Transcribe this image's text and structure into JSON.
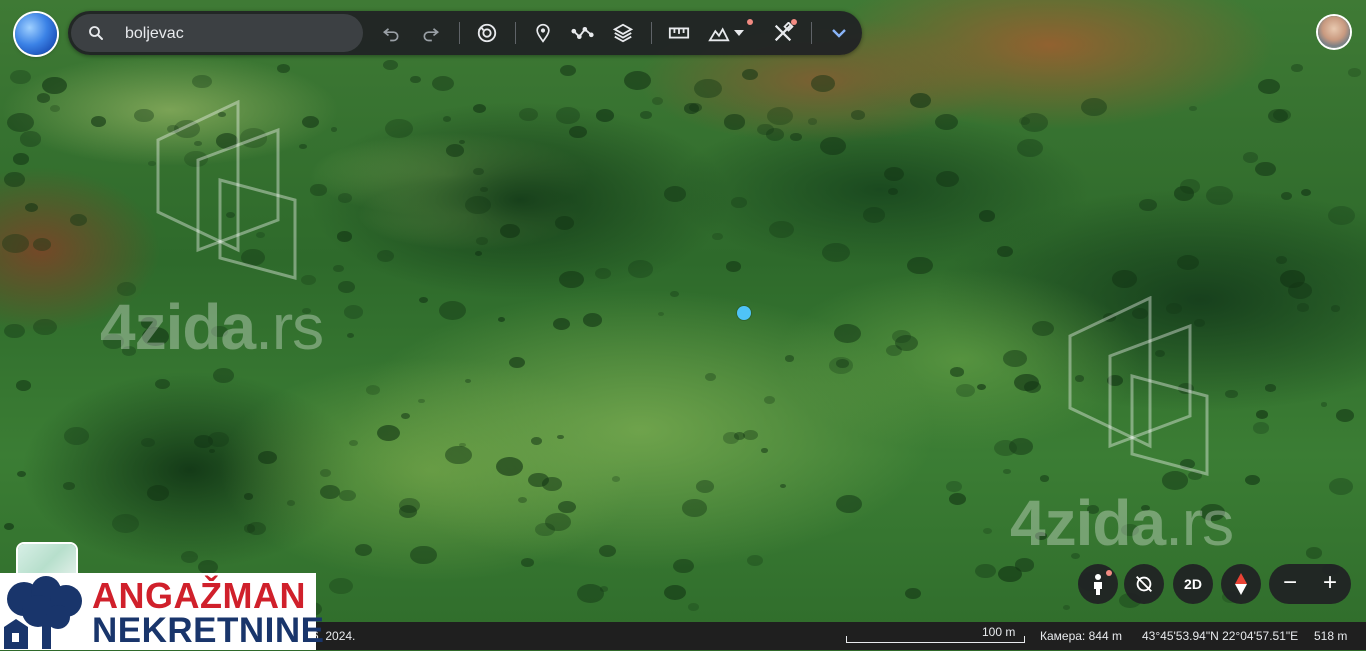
{
  "search": {
    "value": "boljevac",
    "placeholder": ""
  },
  "toolbar": {
    "items": [
      "undo-icon",
      "redo-icon",
      "voyager-icon",
      "placemark-icon",
      "path-icon",
      "layers-icon",
      "ruler-icon",
      "elevation-icon",
      "dropdown-icon",
      "tools-icon",
      "chevron-down-icon"
    ]
  },
  "watermark": {
    "brand": "4zida",
    "tld": ".rs"
  },
  "controls": {
    "view_2d": "2D",
    "zoom_out": "−",
    "zoom_in": "+"
  },
  "status": {
    "date_fragment": "6. 2024.",
    "scale": "100 m",
    "camera": "Камера: 844 m",
    "coords": "43°45'53.94\"N 22°04'57.51\"E",
    "elevation": "518 m"
  },
  "banner": {
    "line1": "ANGAŽMAN",
    "line2": "NEKRETNINE"
  },
  "colors": {
    "pin": "#4fc3f7",
    "banner_red": "#d0202b",
    "banner_blue": "#19356b",
    "toolbar_bg": "#202124"
  }
}
